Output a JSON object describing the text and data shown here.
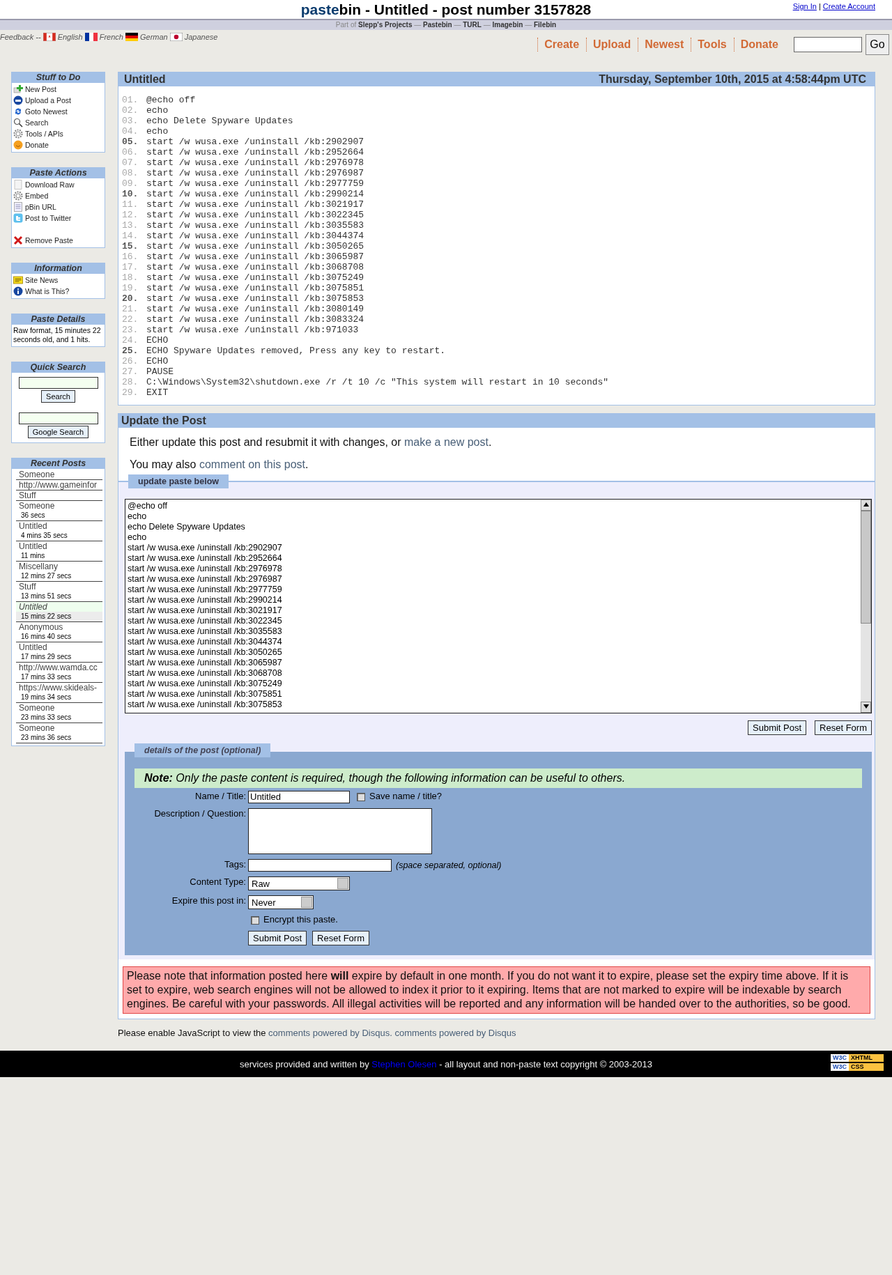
{
  "header": {
    "logo_a": "paste",
    "logo_b": "bin",
    "title": "- Untitled - post number 3157828",
    "account_links": [
      "Sign In",
      "Create Account"
    ],
    "account_separator": "|",
    "projects": "Part of **Slepp's Projects** — **Pastebin** — **TURL** — **Imagebin** — **Filebin**"
  },
  "languages": {
    "feedback": "Feedback",
    "separator": "--",
    "items": [
      {
        "label": "English",
        "kind": "canada"
      },
      {
        "label": "French",
        "kind": "france"
      },
      {
        "label": "German",
        "kind": "germany"
      },
      {
        "label": "Japanese",
        "kind": "japan"
      }
    ]
  },
  "nav": {
    "items": [
      "Create",
      "Upload",
      "Newest",
      "Tools",
      "Donate"
    ],
    "go": "Go"
  },
  "sidebar": {
    "stuff": {
      "title": "Stuff to Do",
      "items": [
        {
          "label": "New Post",
          "kind": "new"
        },
        {
          "label": "Upload a Post",
          "kind": "upload"
        },
        {
          "label": "Goto Newest",
          "kind": "newest"
        },
        {
          "label": "Search",
          "kind": "search"
        },
        {
          "label": "Tools / APIs",
          "kind": "gear"
        },
        {
          "label": "Donate",
          "kind": "smiley"
        }
      ]
    },
    "actions": {
      "title": "Paste Actions",
      "items": [
        {
          "label": "Download Raw",
          "kind": "page"
        },
        {
          "label": "Embed",
          "kind": "gear"
        },
        {
          "label": "pBin URL",
          "kind": "doc"
        },
        {
          "label": "Post to Twitter",
          "kind": "bird"
        },
        {
          "label": "Remove Paste",
          "kind": "cross"
        }
      ]
    },
    "info": {
      "title": "Information",
      "items": [
        {
          "label": "Site News",
          "kind": "news"
        },
        {
          "label": "What is This?",
          "kind": "info"
        }
      ]
    },
    "details": {
      "title": "Paste Details",
      "text": "Raw format, 15 minutes 22 seconds old, and 1 hits."
    },
    "quick": {
      "title": "Quick Search",
      "search_button": "Search",
      "google_button": "Google Search"
    },
    "recent": {
      "title": "Recent Posts",
      "items": [
        {
          "title": "Someone",
          "selected": false
        },
        {
          "title": "http://www.gameinfor",
          "selected": false
        },
        {
          "title": "Stuff",
          "selected": false
        },
        {
          "title": "Someone",
          "age": "36 secs",
          "selected": false
        },
        {
          "title": "Untitled",
          "age": "4 mins 35 secs",
          "selected": false
        },
        {
          "title": "Untitled",
          "age": "11 mins",
          "selected": false
        },
        {
          "title": "Miscellany",
          "age": "12 mins 27 secs",
          "selected": false
        },
        {
          "title": "Stuff",
          "age": "13 mins 51 secs",
          "selected": false
        },
        {
          "title": "Untitled",
          "age": "15 mins 22 secs",
          "selected": true
        },
        {
          "title": "Anonymous",
          "age": "16 mins 40 secs",
          "selected": false
        },
        {
          "title": "Untitled",
          "age": "17 mins 29 secs",
          "selected": false
        },
        {
          "title": "http://www.wamda.cc",
          "age": "17 mins 33 secs",
          "selected": false
        },
        {
          "title": "https://www.skideals-",
          "age": "19 mins 34 secs",
          "selected": false
        },
        {
          "title": "Someone",
          "age": "23 mins 33 secs",
          "selected": false
        },
        {
          "title": "Someone",
          "age": "23 mins 36 secs",
          "selected": false
        }
      ]
    }
  },
  "paste": {
    "title": "Untitled",
    "date": "Thursday, September 10th, 2015 at 4:58:44pm UTC",
    "lines": [
      {
        "n": "01.",
        "text": "@echo off",
        "bold": false
      },
      {
        "n": "02.",
        "text": "echo",
        "bold": false
      },
      {
        "n": "03.",
        "text": "echo Delete Spyware Updates",
        "bold": false
      },
      {
        "n": "04.",
        "text": "echo",
        "bold": false
      },
      {
        "n": "05.",
        "text": "start /w wusa.exe /uninstall /kb:2902907",
        "bold": true
      },
      {
        "n": "06.",
        "text": "start /w wusa.exe /uninstall /kb:2952664",
        "bold": false
      },
      {
        "n": "07.",
        "text": "start /w wusa.exe /uninstall /kb:2976978",
        "bold": false
      },
      {
        "n": "08.",
        "text": "start /w wusa.exe /uninstall /kb:2976987",
        "bold": false
      },
      {
        "n": "09.",
        "text": "start /w wusa.exe /uninstall /kb:2977759",
        "bold": false
      },
      {
        "n": "10.",
        "text": "start /w wusa.exe /uninstall /kb:2990214",
        "bold": true
      },
      {
        "n": "11.",
        "text": "start /w wusa.exe /uninstall /kb:3021917",
        "bold": false
      },
      {
        "n": "12.",
        "text": "start /w wusa.exe /uninstall /kb:3022345",
        "bold": false
      },
      {
        "n": "13.",
        "text": "start /w wusa.exe /uninstall /kb:3035583",
        "bold": false
      },
      {
        "n": "14.",
        "text": "start /w wusa.exe /uninstall /kb:3044374",
        "bold": false
      },
      {
        "n": "15.",
        "text": "start /w wusa.exe /uninstall /kb:3050265",
        "bold": true
      },
      {
        "n": "16.",
        "text": "start /w wusa.exe /uninstall /kb:3065987",
        "bold": false
      },
      {
        "n": "17.",
        "text": "start /w wusa.exe /uninstall /kb:3068708",
        "bold": false
      },
      {
        "n": "18.",
        "text": "start /w wusa.exe /uninstall /kb:3075249",
        "bold": false
      },
      {
        "n": "19.",
        "text": "start /w wusa.exe /uninstall /kb:3075851",
        "bold": false
      },
      {
        "n": "20.",
        "text": "start /w wusa.exe /uninstall /kb:3075853",
        "bold": true
      },
      {
        "n": "21.",
        "text": "start /w wusa.exe /uninstall /kb:3080149",
        "bold": false
      },
      {
        "n": "22.",
        "text": "start /w wusa.exe /uninstall /kb:3083324",
        "bold": false
      },
      {
        "n": "23.",
        "text": "start /w wusa.exe /uninstall /kb:971033",
        "bold": false
      },
      {
        "n": "24.",
        "text": "ECHO",
        "bold": false
      },
      {
        "n": "25.",
        "text": "ECHO Spyware Updates removed, Press any key to restart.",
        "bold": true
      },
      {
        "n": "26.",
        "text": "ECHO",
        "bold": false
      },
      {
        "n": "27.",
        "text": "PAUSE",
        "bold": false
      },
      {
        "n": "28.",
        "text": "C:\\Windows\\System32\\shutdown.exe /r /t 10 /c \"This system will restart in 10 seconds\"",
        "bold": false
      },
      {
        "n": "29.",
        "text": "EXIT",
        "bold": false
      }
    ]
  },
  "update": {
    "title": "Update the Post",
    "line1": "Either update this post and resubmit it with changes, or ",
    "link1": "make a new post",
    "line1_end": ".",
    "line2": "You may also ",
    "link2": "comment on this post",
    "line2_end": ".",
    "tab": "update paste below",
    "textarea_lines": [
      "@echo off",
      "echo",
      "echo Delete Spyware Updates",
      "echo",
      "start /w wusa.exe /uninstall /kb:2902907",
      "start /w wusa.exe /uninstall /kb:2952664",
      "start /w wusa.exe /uninstall /kb:2976978",
      "start /w wusa.exe /uninstall /kb:2976987",
      "start /w wusa.exe /uninstall /kb:2977759",
      "start /w wusa.exe /uninstall /kb:2990214",
      "start /w wusa.exe /uninstall /kb:3021917",
      "start /w wusa.exe /uninstall /kb:3022345",
      "start /w wusa.exe /uninstall /kb:3035583",
      "start /w wusa.exe /uninstall /kb:3044374",
      "start /w wusa.exe /uninstall /kb:3050265",
      "start /w wusa.exe /uninstall /kb:3065987",
      "start /w wusa.exe /uninstall /kb:3068708",
      "start /w wusa.exe /uninstall /kb:3075249",
      "start /w wusa.exe /uninstall /kb:3075851",
      "start /w wusa.exe /uninstall /kb:3075853"
    ],
    "buttons": [
      "Submit Post",
      "Reset Form"
    ]
  },
  "details": {
    "tab": "details of the post (optional)",
    "note": "**Note:** Only the paste content is required, though the following information can be useful to others.",
    "name_label": "Name / Title:",
    "name_value": "Untitled",
    "save_label": "Save name / title?",
    "save_checked": false,
    "description_label": "Description / Question:",
    "tags_label": "Tags:",
    "tags_hint": "(space separated, optional)",
    "content_label": "Content Type:",
    "content_value": "Raw",
    "expire_label": "Expire this post in:",
    "expire_value": "Never",
    "encrypt_label": "Encrypt this paste.",
    "encrypt_checked": false,
    "buttons": [
      "Submit Post",
      "Reset Form"
    ]
  },
  "warning": "Please note that information posted here **will** expire by default in one month. If you do not want it to expire, please set the expiry time above. If it is set to expire, web search engines will not be allowed to index it prior to it expiring. Items that are not marked to expire will be indexable by search engines. Be careful with your passwords. All illegal activities will be reported and any information will be handed over to the authorities, so be good.",
  "disqus": {
    "text": "Please enable JavaScript to view the ",
    "link1": "comments powered by Disqus.",
    "link2": "comments powered by Disqus"
  },
  "footer": {
    "text1": "services provided and written by ",
    "author": "Stephen Olesen",
    "text2": " - all layout and non-paste text copyright © 2003-2013",
    "badges": [
      {
        "w3c": "W3C",
        "label": "XHTML"
      },
      {
        "w3c": "W3C",
        "label": "CSS"
      }
    ]
  }
}
